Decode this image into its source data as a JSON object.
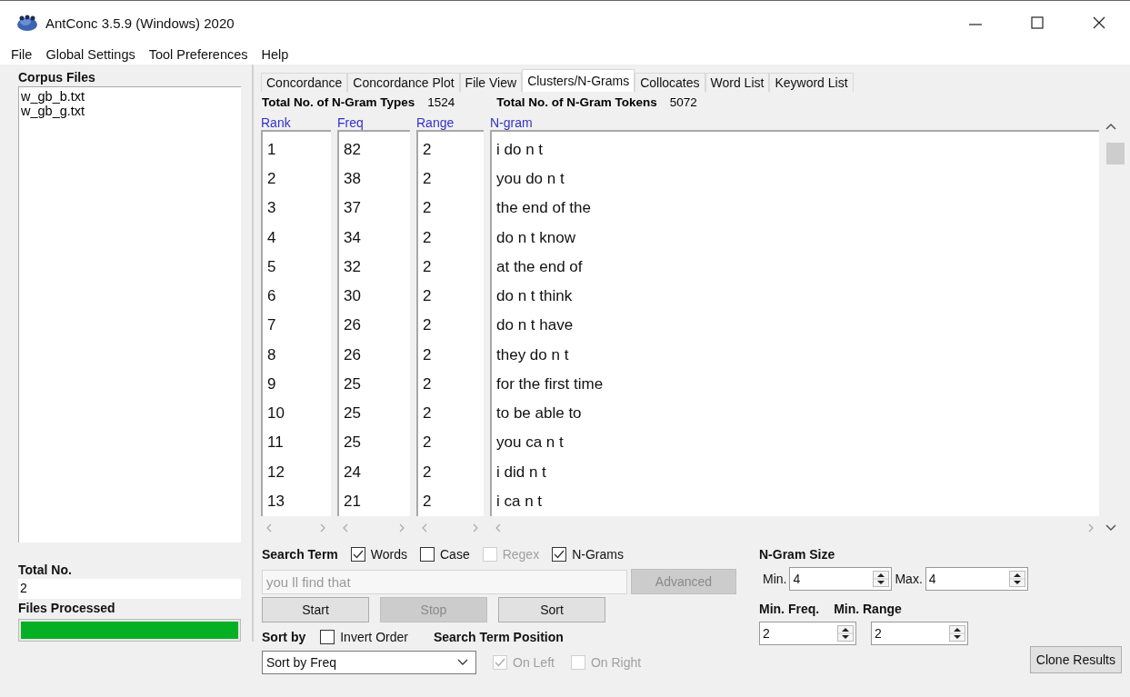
{
  "window": {
    "title": "AntConc 3.5.9 (Windows) 2020"
  },
  "menu": [
    "File",
    "Global Settings",
    "Tool Preferences",
    "Help"
  ],
  "sidebar": {
    "title": "Corpus Files",
    "files": [
      "w_gb_b.txt",
      "w_gb_g.txt"
    ],
    "total_label": "Total No.",
    "total_value": "2",
    "processed_label": "Files Processed",
    "progress": {
      "level": 1
    }
  },
  "tabs": [
    {
      "label": "Concordance",
      "selected": false
    },
    {
      "label": "Concordance Plot",
      "selected": false
    },
    {
      "label": "File View",
      "selected": false
    },
    {
      "label": "Clusters/N-Grams",
      "selected": true
    },
    {
      "label": "Collocates",
      "selected": false
    },
    {
      "label": "Word List",
      "selected": false
    },
    {
      "label": "Keyword List",
      "selected": false
    }
  ],
  "stats": [
    {
      "label": "Total No. of N-Gram Types",
      "value": "1524"
    },
    {
      "label": "Total No. of N-Gram Tokens",
      "value": "5072"
    }
  ],
  "table": {
    "columns": [
      "Rank",
      "Freq",
      "Range",
      "N-gram"
    ],
    "rows": [
      [
        "1",
        "82",
        "2",
        "i do n t"
      ],
      [
        "2",
        "38",
        "2",
        "you do n t"
      ],
      [
        "3",
        "37",
        "2",
        "the end of the"
      ],
      [
        "4",
        "34",
        "2",
        "do n t know"
      ],
      [
        "5",
        "32",
        "2",
        "at the end of"
      ],
      [
        "6",
        "30",
        "2",
        "do n t think"
      ],
      [
        "7",
        "26",
        "2",
        "do n t have"
      ],
      [
        "8",
        "26",
        "2",
        "they do n t"
      ],
      [
        "9",
        "25",
        "2",
        "for the first time"
      ],
      [
        "10",
        "25",
        "2",
        "to be able to"
      ],
      [
        "11",
        "25",
        "2",
        "you ca n t"
      ],
      [
        "12",
        "24",
        "2",
        "i did n t"
      ],
      [
        "13",
        "21",
        "2",
        "i ca n t"
      ]
    ]
  },
  "search": {
    "label": "Search Term",
    "options": [
      {
        "label": "Words",
        "checked": true,
        "disabled": false
      },
      {
        "label": "Case",
        "checked": false,
        "disabled": false
      },
      {
        "label": "Regex",
        "checked": false,
        "disabled": true
      },
      {
        "label": "N-Grams",
        "checked": true,
        "disabled": false
      }
    ],
    "field": {
      "value": "you ll find that",
      "disabled": true
    },
    "advanced": {
      "label": "Advanced",
      "disabled": true
    },
    "buttons": [
      {
        "label": "Start",
        "disabled": false
      },
      {
        "label": "Stop",
        "disabled": true
      },
      {
        "label": "Sort",
        "disabled": false
      }
    ],
    "sort_label": "Sort by",
    "invert": {
      "label": "Invert Order",
      "checked": false,
      "disabled": false
    },
    "sort_select": "Sort by Freq",
    "position_label": "Search Term Position",
    "positions": [
      {
        "label": "On Left",
        "checked": true,
        "disabled": true
      },
      {
        "label": "On Right",
        "checked": false,
        "disabled": true
      }
    ]
  },
  "ngram": {
    "size_label": "N-Gram Size",
    "min_label": "Min.",
    "min_value": "4",
    "max_label": "Max.",
    "max_value": "4",
    "freq_label": "Min. Freq.",
    "range_label": "Min. Range",
    "freq_value": "2",
    "range_value": "2"
  },
  "clone_button": "Clone Results"
}
